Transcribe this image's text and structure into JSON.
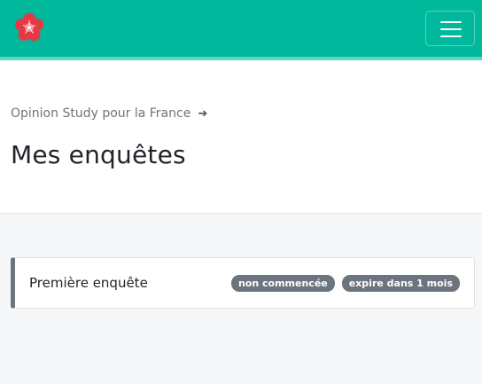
{
  "navbar": {
    "logo_icon": "red-flower-logo-icon",
    "menu_icon": "hamburger-menu-icon",
    "colors": {
      "background": "#00b89c",
      "stripe": "#5fd6c3"
    }
  },
  "breadcrumb": {
    "link": "Opinion Study pour la France",
    "arrow": "➔"
  },
  "page_title": "Mes enquêtes",
  "surveys": [
    {
      "name": "Première enquête",
      "badges": [
        "non commencée",
        "expire dans 1 mois"
      ]
    }
  ]
}
